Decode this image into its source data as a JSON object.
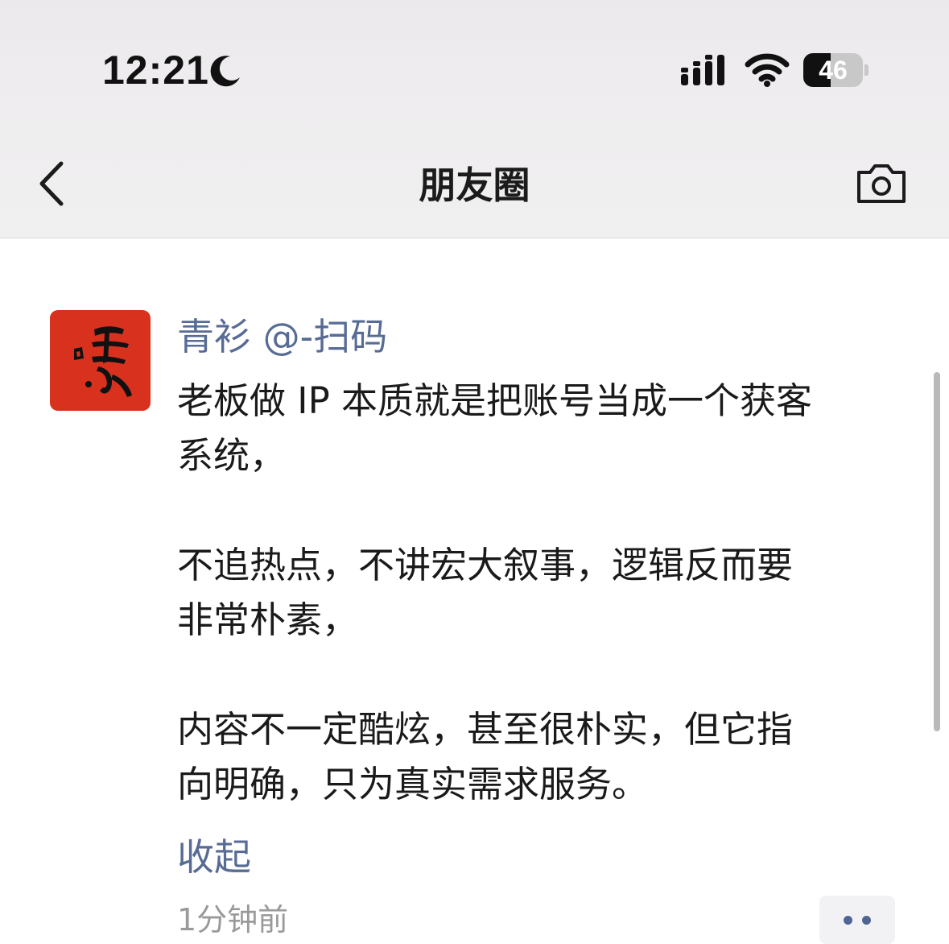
{
  "status_bar": {
    "time": "12:21",
    "battery_level": "46",
    "icons": [
      "moon-icon",
      "cellular-signal-icon",
      "wifi-icon",
      "battery-icon"
    ]
  },
  "nav": {
    "title": "朋友圈",
    "back_icon": "chevron-left-icon",
    "camera_icon": "camera-icon"
  },
  "post": {
    "user_name": "青衫 @-扫码",
    "paragraphs": [
      [
        "老板做 IP 本质就是把账号当成一个获客",
        "系统，"
      ],
      [
        "不追热点，不讲宏大叙事，逻辑反而要",
        "非常朴素，"
      ],
      [
        "内容不一定酷炫，甚至很朴实，但它指",
        "向明确，只为真实需求服务。"
      ]
    ],
    "collapse_label": "收起",
    "time_ago": "1分钟前",
    "more_icon": "more-dots-icon"
  },
  "colors": {
    "link": "#576b95",
    "avatar_bg": "#d8321f",
    "topbar_bg": "#efeef0"
  }
}
